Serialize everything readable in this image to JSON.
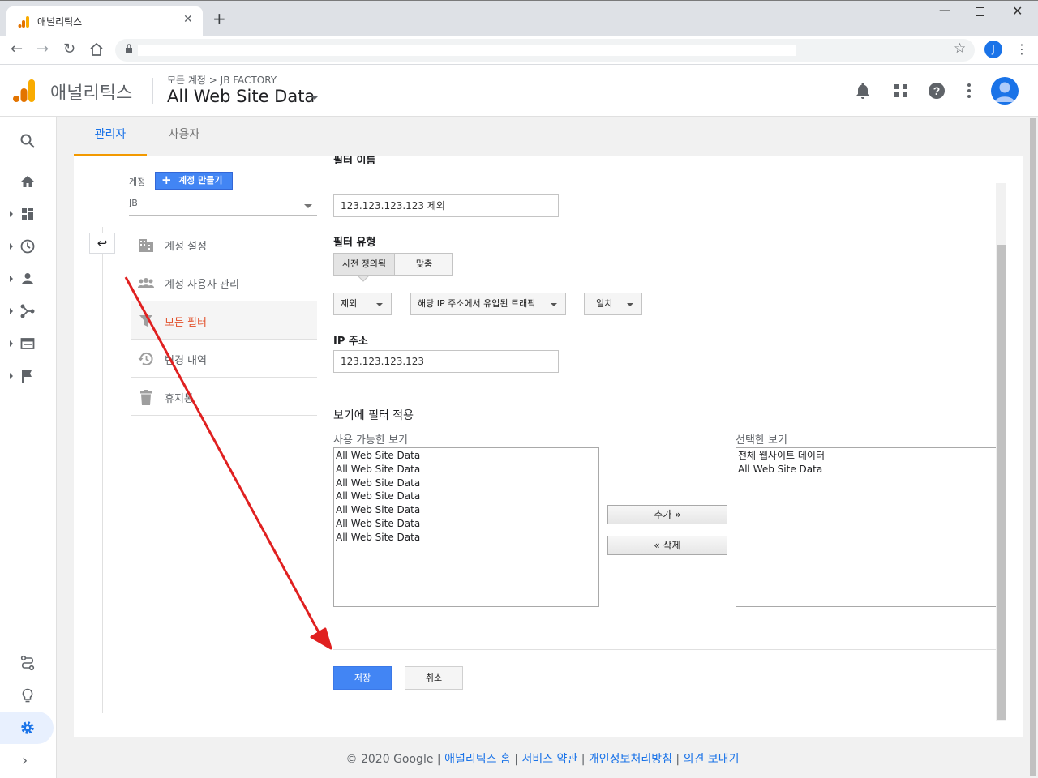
{
  "browser": {
    "tab_title": "애널리틱스",
    "tab_close": "✕",
    "new_tab": "+",
    "profile_initial": "J"
  },
  "header": {
    "brand": "애널리틱스",
    "breadcrumb": "모든 계정 > JB FACTORY",
    "view_name": "All Web Site Data"
  },
  "tabs": {
    "admin": "관리자",
    "user": "사용자"
  },
  "account": {
    "label": "계정",
    "create_button": "계정 만들기",
    "selected": "JB"
  },
  "menu": [
    {
      "label": "계정 설정",
      "icon": "building-icon"
    },
    {
      "label": "계정 사용자 관리",
      "icon": "people-icon"
    },
    {
      "label": "모든 필터",
      "icon": "filter-icon"
    },
    {
      "label": "변경 내역",
      "icon": "history-icon"
    },
    {
      "label": "휴지통",
      "icon": "trash-icon"
    }
  ],
  "form": {
    "filter_name_label": "필터 이름",
    "filter_name_value": "123.123.123.123 제외",
    "filter_type_label": "필터 유형",
    "type_predefined": "사전 정의됨",
    "type_custom": "맞춤",
    "dd_action": "제외",
    "dd_source": "해당 IP 주소에서 유입된 트래픽",
    "dd_match": "일치",
    "ip_label": "IP 주소",
    "ip_value": "123.123.123.123",
    "apply_title": "보기에 필터 적용",
    "available_label": "사용 가능한 보기",
    "available_views": [
      "All Web Site Data",
      "All Web Site Data",
      "All Web Site Data",
      "All Web Site Data",
      "All Web Site Data",
      "All Web Site Data",
      "All Web Site Data"
    ],
    "selected_label": "선택한 보기",
    "selected_views": [
      "전체 웹사이트 데이터",
      "All Web Site Data"
    ],
    "add_button": "추가 »",
    "remove_button": "« 삭제",
    "save_button": "저장",
    "cancel_button": "취소"
  },
  "footer": {
    "copyright": "© 2020 Google",
    "sep": " | ",
    "links": [
      "애널리틱스 홈",
      "서비스 약관",
      "개인정보처리방침",
      "의견 보내기"
    ]
  },
  "colors": {
    "accent": "#4285f4",
    "active_menu": "#e2502a",
    "tab_underline": "#f29900",
    "annotation": "#e02020"
  }
}
